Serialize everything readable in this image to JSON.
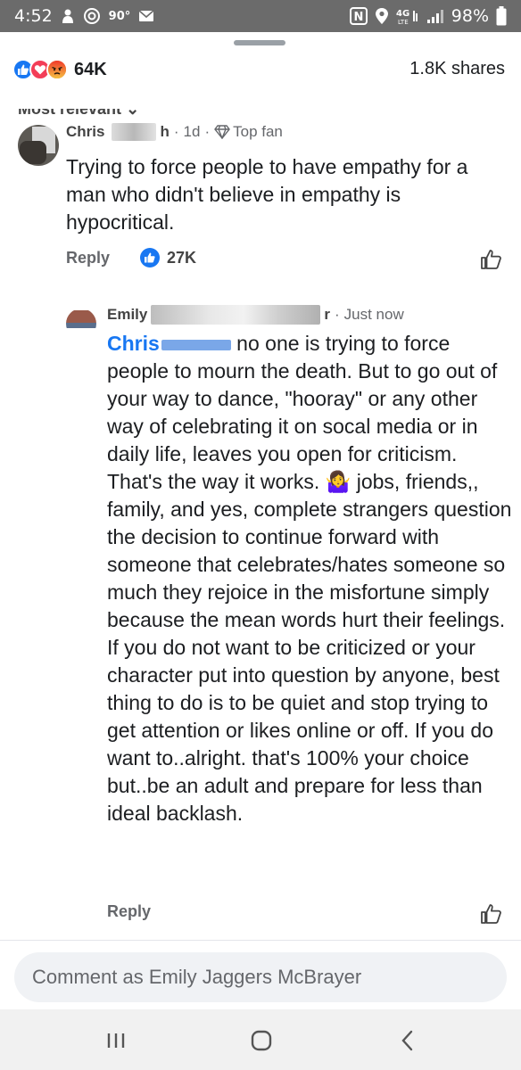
{
  "status_bar": {
    "time": "4:52",
    "temperature": "90°",
    "battery": "98%"
  },
  "post_stats": {
    "reactions_count": "64K",
    "shares": "1.8K shares",
    "sort_label": "Most relevant"
  },
  "comments": [
    {
      "author": "Chris",
      "author_suffix": "h",
      "time": "1d",
      "badge": "Top fan",
      "text": "Trying to force people to have empathy for a man who didn't believe in empathy is hypocritical.",
      "reply_label": "Reply",
      "likes": "27K"
    },
    {
      "author": "Emily",
      "author_suffix": "r",
      "time": "Just now",
      "mention": "Chris",
      "text": " no one is trying to force people to mourn the death. But to go out of your way to dance, \"hooray\" or any other way of celebrating it on socal media or in daily life, leaves you open for criticism. That's the way it works. 🤷‍♀️ jobs, friends,, family, and yes, complete strangers question the decision to continue forward with someone that celebrates/hates someone so much they rejoice in the misfortune simply because the mean words hurt their feelings. If you do not want to be criticized or your character put into question by anyone, best thing to do is to be quiet and stop trying to get attention or likes online or off. If you do want to..alright. that's 100% your choice but..be an adult and prepare for less than ideal backlash.",
      "reply_label": "Reply"
    }
  ],
  "composer": {
    "placeholder": "Comment as Emily Jaggers McBrayer"
  },
  "colors": {
    "accent": "#1877f2",
    "status_bar": "#6b6b6b"
  },
  "icons": [
    "person-icon",
    "signal-icon",
    "notification-icon",
    "nfc-icon",
    "location-icon",
    "wifi-icon",
    "cell-signal-icon",
    "battery-icon",
    "like-icon",
    "love-icon",
    "angry-icon",
    "diamond-icon",
    "thumbs-up-icon",
    "recent-apps-icon",
    "home-icon",
    "back-icon"
  ]
}
